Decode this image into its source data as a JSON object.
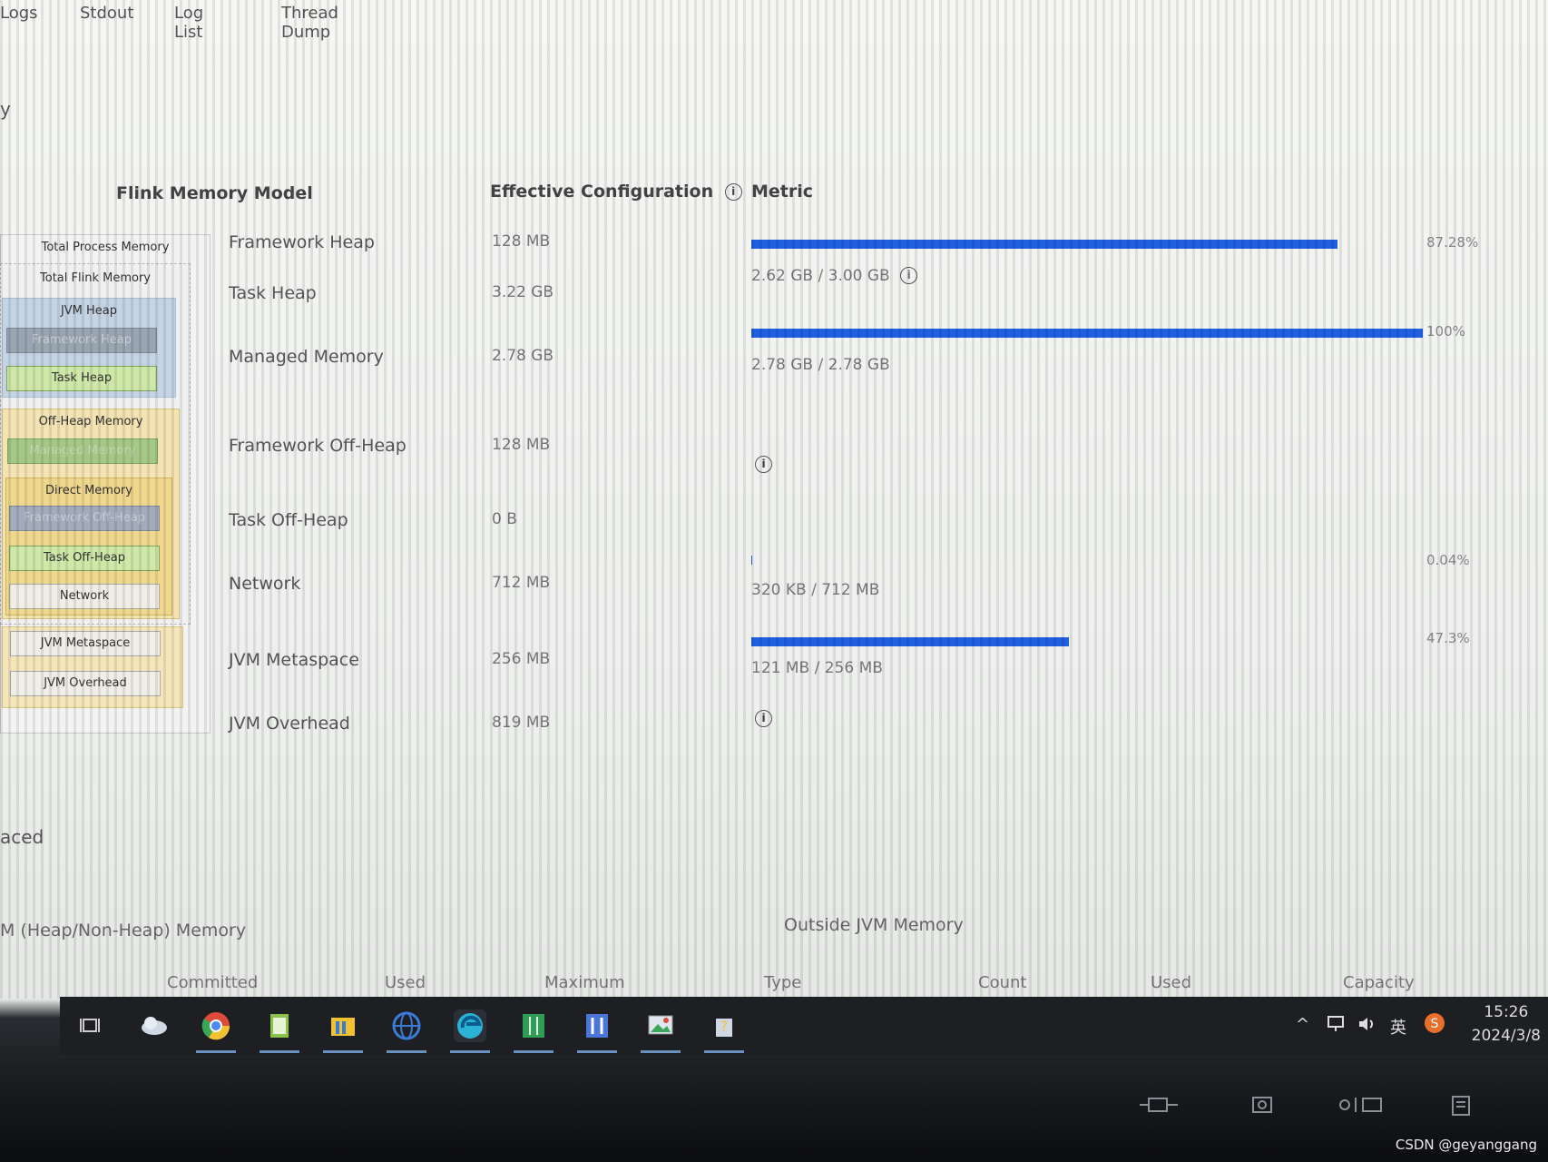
{
  "tabs": [
    "Logs",
    "Stdout",
    "Log List",
    "Thread Dump"
  ],
  "section_fragments": {
    "top": "y",
    "advanced": "aced"
  },
  "model": {
    "title": "Flink Memory Model",
    "total_process": "Total Process Memory",
    "total_flink": "Total Flink Memory",
    "jvm_heap": "JVM Heap",
    "framework_heap": "Framework Heap",
    "task_heap": "Task Heap",
    "off_heap": "Off-Heap Memory",
    "managed_memory": "Managed Memory",
    "direct_memory": "Direct Memory",
    "framework_off_heap": "Framework Off-Heap",
    "task_off_heap": "Task Off-Heap",
    "network": "Network",
    "jvm_metaspace": "JVM Metaspace",
    "jvm_overhead": "JVM Overhead"
  },
  "table": {
    "headers": {
      "effective": "Effective Configuration",
      "metric": "Metric"
    },
    "info_glyph": "i",
    "rows": [
      {
        "label": "Framework Heap",
        "value": "128 MB"
      },
      {
        "label": "Task Heap",
        "value": "3.22 GB"
      },
      {
        "label": "Managed Memory",
        "value": "2.78 GB"
      },
      {
        "label": "Framework Off-Heap",
        "value": "128 MB"
      },
      {
        "label": "Task Off-Heap",
        "value": "0 B"
      },
      {
        "label": "Network",
        "value": "712 MB"
      },
      {
        "label": "JVM Metaspace",
        "value": "256 MB"
      },
      {
        "label": "JVM Overhead",
        "value": "819 MB"
      }
    ],
    "metrics": [
      {
        "usage": "2.62 GB / 3.00 GB",
        "percent": "87.28%",
        "fill": 0.8728
      },
      {
        "usage": "2.78 GB / 2.78 GB",
        "percent": "100%",
        "fill": 1.0
      },
      {
        "usage": "320 KB / 712 MB",
        "percent": "0.04%",
        "fill": 0.0004
      },
      {
        "usage": "121 MB / 256 MB",
        "percent": "47.3%",
        "fill": 0.473
      }
    ]
  },
  "bottom": {
    "jvm_memory_title": "M (Heap/Non-Heap) Memory",
    "outside_title": "Outside JVM Memory",
    "jvm_columns": [
      "Committed",
      "Used",
      "Maximum"
    ],
    "outside_columns": [
      "Type",
      "Count",
      "Used",
      "Capacity"
    ]
  },
  "taskbar": {
    "time": "15:26",
    "date": "2024/3/8",
    "ime": "英",
    "apps": [
      "task-view",
      "cloud-app",
      "chrome",
      "notepad",
      "file-explorer",
      "globe-browser",
      "edge",
      "spreadsheet",
      "ide",
      "image-viewer",
      "help"
    ],
    "colors": {
      "chrome": "#dd4b39",
      "notepad": "#8bc34a",
      "explorer": "#f2c230",
      "browser": "#3a7bd5",
      "edge": "#2bb3d6",
      "sheet": "#2e9e57",
      "ide": "#4a76d8"
    }
  },
  "watermark": "CSDN @geyanggang"
}
